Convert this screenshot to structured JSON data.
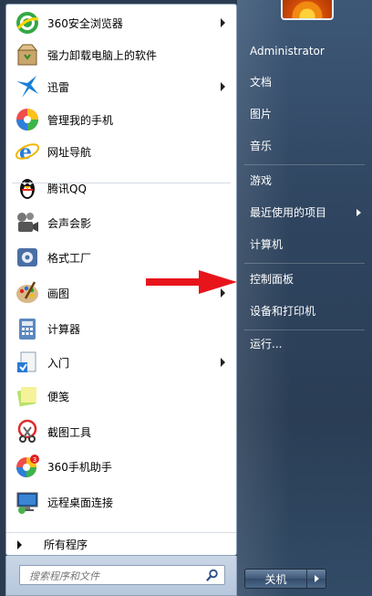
{
  "programs": [
    {
      "label": "360安全浏览器",
      "icon": "360-browser-icon",
      "submenu": true
    },
    {
      "label": "强力卸载电脑上的软件",
      "icon": "uninstall-box-icon",
      "submenu": false
    },
    {
      "label": "迅雷",
      "icon": "thunder-bird-icon",
      "submenu": true
    },
    {
      "label": "管理我的手机",
      "icon": "phone-manager-icon",
      "submenu": false
    },
    {
      "label": "网址导航",
      "icon": "ie-browser-icon",
      "submenu": false
    },
    {
      "label": "腾讯QQ",
      "icon": "qq-penguin-icon",
      "submenu": false
    },
    {
      "label": "会声会影",
      "icon": "video-camera-icon",
      "submenu": false
    },
    {
      "label": "格式工厂",
      "icon": "format-factory-icon",
      "submenu": false
    },
    {
      "label": "画图",
      "icon": "paint-palette-icon",
      "submenu": true
    },
    {
      "label": "计算器",
      "icon": "calculator-icon",
      "submenu": false
    },
    {
      "label": "入门",
      "icon": "getting-started-icon",
      "submenu": true
    },
    {
      "label": "便笺",
      "icon": "sticky-notes-icon",
      "submenu": false
    },
    {
      "label": "截图工具",
      "icon": "snipping-tool-icon",
      "submenu": false
    },
    {
      "label": "360手机助手",
      "icon": "360-phone-assistant-icon",
      "submenu": false
    },
    {
      "label": "远程桌面连接",
      "icon": "remote-desktop-icon",
      "submenu": false
    }
  ],
  "all_programs_label": "所有程序",
  "search": {
    "placeholder": "搜索程序和文件"
  },
  "right_menu": {
    "user": "Administrator",
    "documents": "文档",
    "pictures": "图片",
    "music": "音乐",
    "games": "游戏",
    "recent_items": "最近使用的项目",
    "computer": "计算机",
    "control_panel": "控制面板",
    "devices_printers": "设备和打印机",
    "run": "运行..."
  },
  "shutdown_label": "关机",
  "colors": {
    "annotation_arrow": "#e8141c",
    "right_pane": "#2f4560"
  }
}
